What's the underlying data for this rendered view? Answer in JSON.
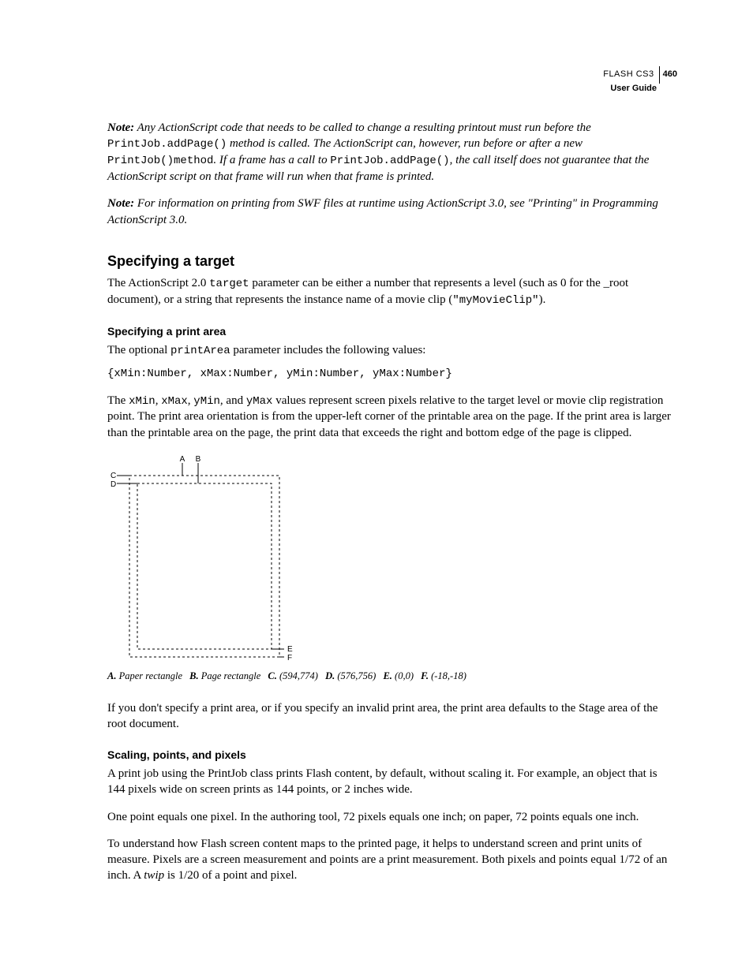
{
  "header": {
    "product": "FLASH CS3",
    "page_number": "460",
    "guide": "User Guide"
  },
  "note1": {
    "label": "Note:",
    "part1": " Any ActionScript code that needs to be called to change a resulting printout must run before the ",
    "code1": "PrintJob.addPage()",
    "part2": " method is called. The ActionScript can, however, run before or after a new ",
    "code2": "PrintJob()method",
    "part3": ". If a frame has a call to ",
    "code3": "PrintJob.addPage()",
    "part4": ", the call itself does not guarantee that the Action­Script script on that frame will run when that frame is printed."
  },
  "note2": {
    "label": "Note:",
    "text": " For information on printing from SWF files at runtime using ActionScript 3.0, see \"Printing\" in Programming ActionScript 3.0."
  },
  "section1": {
    "title": "Specifying a target",
    "para_a": "The ActionScript 2.0 ",
    "para_code1": "target",
    "para_b": " parameter can be either a number that represents a level (such as 0 for the _root document), or a string that represents the instance name of a movie clip (",
    "para_code2": "\"myMovieClip\"",
    "para_c": ")."
  },
  "section2": {
    "title": "Specifying a print area",
    "intro_a": "The optional ",
    "intro_code": "printArea",
    "intro_b": " parameter includes the following values:",
    "code_block": "{xMin:Number, xMax:Number, yMin:Number, yMax:Number}",
    "desc_a": "The ",
    "desc_c1": "xMin",
    "sep": ", ",
    "desc_c2": "xMax",
    "desc_c3": "yMin",
    "and": ", and ",
    "desc_c4": "yMax",
    "desc_b": " values represent screen pixels relative to the target level or movie clip registration point. The print area orientation is from the upper-left corner of the printable area on the page. If the print area is larger than the printable area on the page, the print data that exceeds the right and bottom edge of the page is clipped."
  },
  "diagram": {
    "labels": {
      "A": "A",
      "B": "B",
      "C": "C",
      "D": "D",
      "E": "E",
      "F": "F"
    }
  },
  "legend": {
    "A": {
      "label": "A.",
      "text": "Paper rectangle"
    },
    "B": {
      "label": "B.",
      "text": "Page rectangle"
    },
    "C": {
      "label": "C.",
      "text": "(594,774)"
    },
    "D": {
      "label": "D.",
      "text": "(576,756)"
    },
    "E": {
      "label": "E.",
      "text": "(0,0)"
    },
    "F": {
      "label": "F.",
      "text": "(-18,-18)"
    }
  },
  "after_diagram": "If you don't specify a print area, or if you specify an invalid print area, the print area defaults to the Stage area of the root document.",
  "section3": {
    "title": "Scaling, points, and pixels",
    "p1": "A print job using the PrintJob class prints Flash content, by default, without scaling it. For example, an object that is 144 pixels wide on screen prints as 144 points, or 2 inches wide.",
    "p2": "One point equals one pixel. In the authoring tool, 72 pixels equals one inch; on paper, 72 points equals one inch.",
    "p3a": "To understand how Flash screen content maps to the printed page, it helps to understand screen and print units of measure. Pixels are a screen measurement and points are a print measurement. Both pixels and points equal 1/72 of an inch. A ",
    "p3_em": "twip",
    "p3b": " is 1/20 of a point and pixel."
  }
}
